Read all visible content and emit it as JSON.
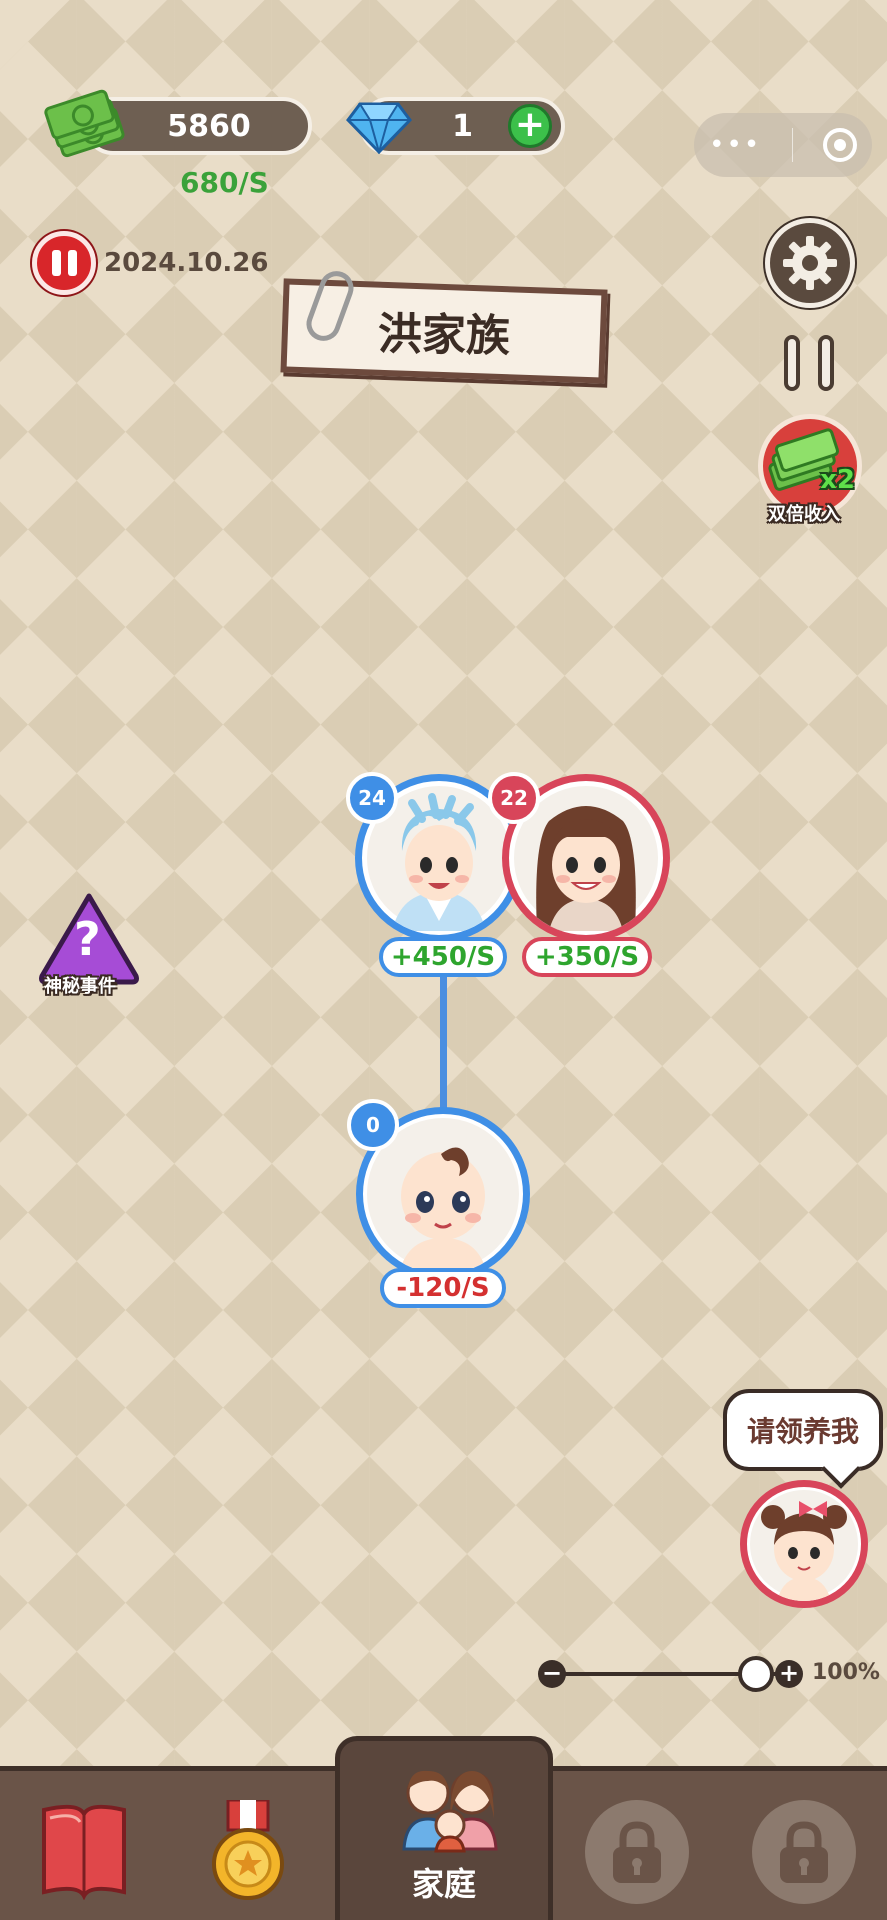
{
  "currency": {
    "cash": "5860",
    "cash_rate": "680/S",
    "gems": "1",
    "add": "+"
  },
  "status": {
    "date": "2024.10.26"
  },
  "family": {
    "name": "洪家族"
  },
  "side_buttons": {
    "double_income_badge": "x2",
    "double_income_label": "双倍收入",
    "mystery_symbol": "?",
    "mystery_label": "神秘事件"
  },
  "members": [
    {
      "role": "father",
      "level": "24",
      "rate": "+450/S",
      "color": "#3f8fe6"
    },
    {
      "role": "mother",
      "level": "22",
      "rate": "+350/S",
      "color": "#d8455a"
    },
    {
      "role": "baby",
      "level": "0",
      "rate": "-120/S",
      "color": "#3f8fe6"
    }
  ],
  "adopt": {
    "message": "请领养我"
  },
  "zoom": {
    "minus": "−",
    "plus": "+",
    "level": "100%",
    "value_fraction": 0.85
  },
  "bottom_nav": {
    "active_label": "家庭"
  },
  "colors": {
    "positive": "#2ea52e",
    "negative": "#d43030",
    "male": "#3f8fe6",
    "female": "#d8455a"
  }
}
